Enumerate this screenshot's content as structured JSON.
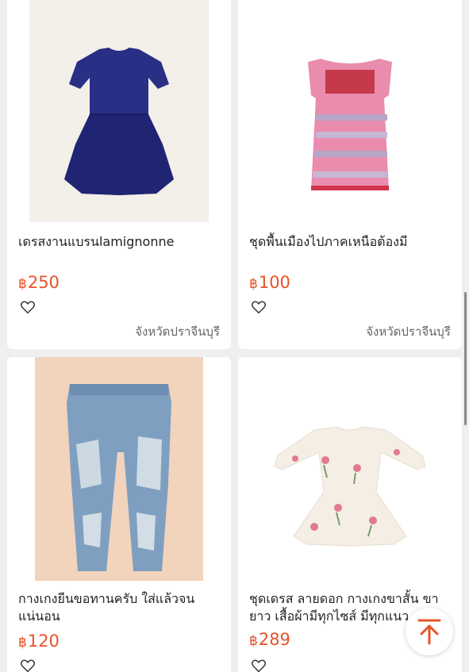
{
  "currency_symbol": "฿",
  "accent_color": "#e8532a",
  "products": [
    {
      "title": "เดรสงานแบรนlamignonne",
      "price": "250",
      "location": "จังหวัดปราจีนบุรี",
      "image": "navy-dress"
    },
    {
      "title": "ชุดพื้นเมืองไปภาคเหนือต้องมี",
      "price": "100",
      "location": "จังหวัดปราจีนบุรี",
      "image": "pink-tribal-dress"
    },
    {
      "title": "กางเกงยีนขอทานครับ ใส่แล้วจนแน่นอน",
      "price": "120",
      "image": "ripped-jeans"
    },
    {
      "title": "ชุดเดรส ลายดอก กางเกงขาสั้น ขายาว เสื้อผ้ามีทุกไซส์ มีทุกแนว",
      "price": "289",
      "image": "floral-dress"
    }
  ],
  "icons": {
    "favorite": "heart-outline-icon",
    "back_to_top": "arrow-up-to-top-icon"
  }
}
